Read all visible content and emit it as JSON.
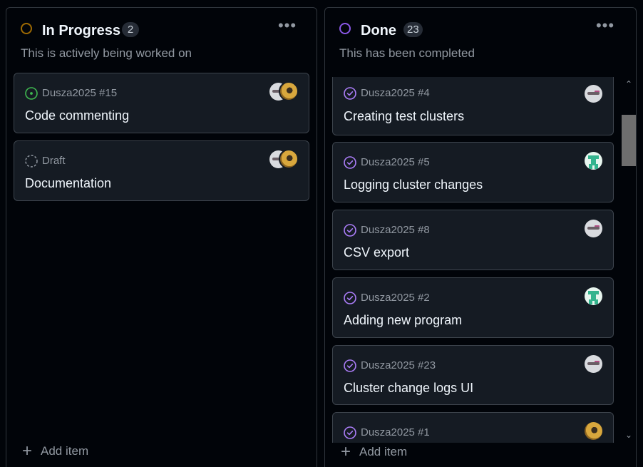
{
  "colors": {
    "in_progress_ring": "#9e6a03",
    "done_ring": "#8957e5",
    "open_icon": "#3fb950",
    "draft_icon": "#9198a1",
    "closed_icon": "#ab7df8"
  },
  "columns": [
    {
      "title": "In Progress",
      "count": "2",
      "description": "This is actively being worked on",
      "add_label": "Add item",
      "cards": [
        {
          "meta": "Dusza2025 #15",
          "title": "Code commenting",
          "status_icon": "issue-open-icon",
          "avatars": [
            "avatar-gray",
            "avatar-gold"
          ]
        },
        {
          "meta": "Draft",
          "title": "Documentation",
          "status_icon": "draft-icon",
          "avatars": [
            "avatar-gray",
            "avatar-gold"
          ]
        }
      ]
    },
    {
      "title": "Done",
      "count": "23",
      "description": "This has been completed",
      "add_label": "Add item",
      "cards": [
        {
          "meta": "Dusza2025 #4",
          "title": "Creating test clusters",
          "status_icon": "issue-closed-icon",
          "avatars": [
            "avatar-gray"
          ]
        },
        {
          "meta": "Dusza2025 #5",
          "title": "Logging cluster changes",
          "status_icon": "issue-closed-icon",
          "avatars": [
            "avatar-teal"
          ]
        },
        {
          "meta": "Dusza2025 #8",
          "title": "CSV export",
          "status_icon": "issue-closed-icon",
          "avatars": [
            "avatar-gray"
          ]
        },
        {
          "meta": "Dusza2025 #2",
          "title": "Adding new program",
          "status_icon": "issue-closed-icon",
          "avatars": [
            "avatar-teal"
          ]
        },
        {
          "meta": "Dusza2025 #23",
          "title": "Cluster change logs UI",
          "status_icon": "issue-closed-icon",
          "avatars": [
            "avatar-gray"
          ]
        },
        {
          "meta": "Dusza2025 #1",
          "title": "",
          "status_icon": "issue-closed-icon",
          "avatars": [
            "avatar-gold"
          ]
        }
      ]
    }
  ]
}
